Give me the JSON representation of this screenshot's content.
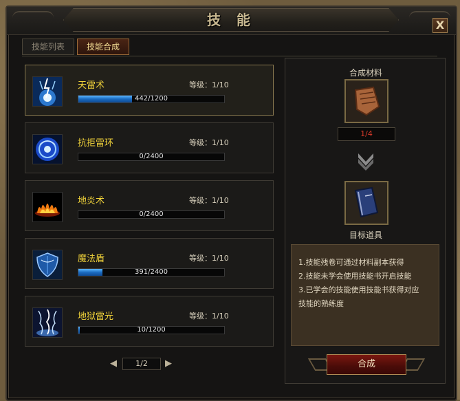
{
  "window": {
    "title": "技 能",
    "close_label": "X"
  },
  "tabs": [
    {
      "label": "技能列表",
      "active": false
    },
    {
      "label": "技能合成",
      "active": true
    }
  ],
  "skills": [
    {
      "name": "天雷术",
      "level": "等级：1/10",
      "progress_text": "442/1200",
      "progress": 0.368,
      "icon": "thunder-strike-icon",
      "selected": true
    },
    {
      "name": "抗拒雷环",
      "level": "等级：1/10",
      "progress_text": "0/2400",
      "progress": 0,
      "icon": "repel-ring-icon",
      "selected": false
    },
    {
      "name": "地炎术",
      "level": "等级：1/10",
      "progress_text": "0/2400",
      "progress": 0,
      "icon": "ground-fire-icon",
      "selected": false
    },
    {
      "name": "魔法盾",
      "level": "等级：1/10",
      "progress_text": "391/2400",
      "progress": 0.163,
      "icon": "magic-shield-icon",
      "selected": false
    },
    {
      "name": "地狱雷光",
      "level": "等级：1/10",
      "progress_text": "10/1200",
      "progress": 0.008,
      "icon": "hell-lightning-icon",
      "selected": false
    }
  ],
  "pager": {
    "text": "1/2"
  },
  "synthesis": {
    "material_label": "合成材料",
    "material_count": "1/4",
    "target_label": "目标道具",
    "button_label": "合成",
    "description": [
      "1.技能残卷可通过材料副本获得",
      "2.技能未学会使用技能书开启技能",
      "3.已学会的技能使用技能书获得对应",
      "技能的熟练度"
    ]
  },
  "colors": {
    "skill_name": "#f0d23a",
    "progress_fill": "#1a6ac0",
    "material_count": "#d83a2a"
  }
}
